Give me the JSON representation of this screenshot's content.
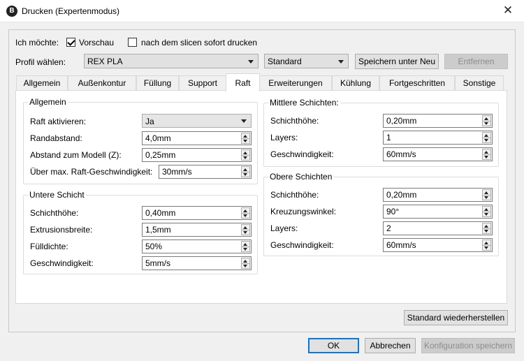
{
  "window": {
    "title": "Drucken (Expertenmodus)",
    "app_icon": "B",
    "close_glyph": "✕"
  },
  "top": {
    "want_label": "Ich möchte:",
    "preview_label": "Vorschau",
    "preview_checked": true,
    "print_after_slice_label": "nach dem slicen sofort drucken",
    "print_after_slice_checked": false,
    "profile_label": "Profil wählen:",
    "profile_value": "REX PLA",
    "preset_value": "Standard",
    "save_as_label": "Speichern unter Neu",
    "remove_label": "Entfernen"
  },
  "tabs": [
    {
      "label": "Allgemein"
    },
    {
      "label": "Außenkontur"
    },
    {
      "label": "Füllung"
    },
    {
      "label": "Support"
    },
    {
      "label": "Raft"
    },
    {
      "label": "Erweiterungen"
    },
    {
      "label": "Kühlung"
    },
    {
      "label": "Fortgeschritten"
    },
    {
      "label": "Sonstige"
    }
  ],
  "active_tab": "Raft",
  "groups": {
    "general": {
      "title": "Allgemein",
      "raft_label": "Raft aktivieren:",
      "raft_value": "Ja",
      "margin_label": "Randabstand:",
      "margin_value": "4,0mm",
      "distance_label": "Abstand zum Modell (Z):",
      "distance_value": "0,25mm",
      "speed_label": "Über max. Raft-Geschwindigkeit:",
      "speed_value": "30mm/s"
    },
    "lower": {
      "title": "Untere Schicht",
      "layer_height_label": "Schichthöhe:",
      "layer_height_value": "0,40mm",
      "extrusion_width_label": "Extrusionsbreite:",
      "extrusion_width_value": "1,5mm",
      "fill_density_label": "Fülldichte:",
      "fill_density_value": "50%",
      "speed_label": "Geschwindigkeit:",
      "speed_value": "5mm/s"
    },
    "middle": {
      "title": "Mittlere Schichten:",
      "layer_height_label": "Schichthöhe:",
      "layer_height_value": "0,20mm",
      "layers_label": "Layers:",
      "layers_value": "1",
      "speed_label": "Geschwindigkeit:",
      "speed_value": "60mm/s"
    },
    "upper": {
      "title": "Obere Schichten",
      "layer_height_label": "Schichthöhe:",
      "layer_height_value": "0,20mm",
      "cross_angle_label": "Kreuzungswinkel:",
      "cross_angle_value": "90°",
      "layers_label": "Layers:",
      "layers_value": "2",
      "speed_label": "Geschwindigkeit:",
      "speed_value": "60mm/s"
    }
  },
  "footer": {
    "restore_label": "Standard wiederherstellen",
    "ok_label": "OK",
    "cancel_label": "Abbrechen",
    "save_config_label": "Konfiguration speichern"
  },
  "colors": {
    "accent": "#0078d7",
    "window_bg": "#f0f0f0",
    "panel_bg": "#ffffff"
  }
}
